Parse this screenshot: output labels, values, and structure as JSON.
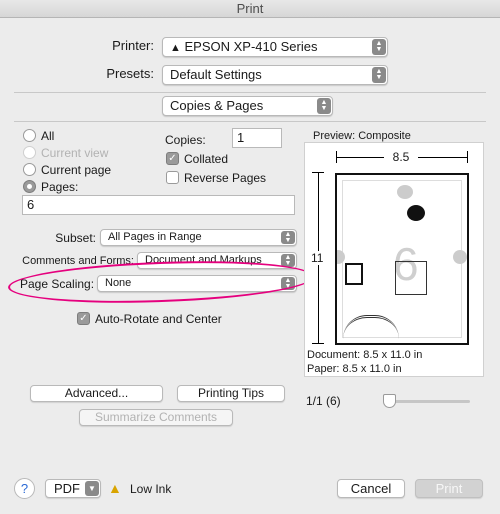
{
  "window": {
    "title": "Print"
  },
  "printer": {
    "label": "Printer:",
    "value": "EPSON XP-410 Series"
  },
  "presets": {
    "label": "Presets:",
    "value": "Default Settings"
  },
  "section": {
    "value": "Copies & Pages"
  },
  "pages": {
    "all": "All",
    "current_view": "Current view",
    "current_page": "Current page",
    "pages": "Pages:",
    "pages_value": "6",
    "selected": "Pages:"
  },
  "copies": {
    "label": "Copies:",
    "value": "1",
    "collated": "Collated",
    "collated_checked": true,
    "reverse": "Reverse Pages",
    "reverse_checked": false
  },
  "subset": {
    "label": "Subset:",
    "value": "All Pages in Range"
  },
  "comments": {
    "label": "Comments and Forms:",
    "value": "Document and Markups"
  },
  "scaling": {
    "label": "Page Scaling:",
    "value": "None",
    "highlight_color": "#e5007e"
  },
  "auto_rotate": {
    "label": "Auto-Rotate and Center",
    "checked": true
  },
  "buttons": {
    "advanced": "Advanced...",
    "printing_tips": "Printing Tips",
    "summarize": "Summarize Comments"
  },
  "preview": {
    "title": "Preview: Composite",
    "width_label": "8.5",
    "height_label": "11",
    "page_number": "6",
    "document_size": "Document: 8.5 x 11.0 in",
    "paper_size": "Paper: 8.5 x 11.0 in",
    "page_indicator": "1/1 (6)"
  },
  "footer": {
    "help": "?",
    "pdf": "PDF",
    "status": "Low Ink",
    "cancel": "Cancel",
    "print": "Print"
  },
  "icons": {
    "printer_warning": "warning-icon",
    "stepper": "chevron-updown-icon",
    "status_warning": "warning-icon"
  }
}
